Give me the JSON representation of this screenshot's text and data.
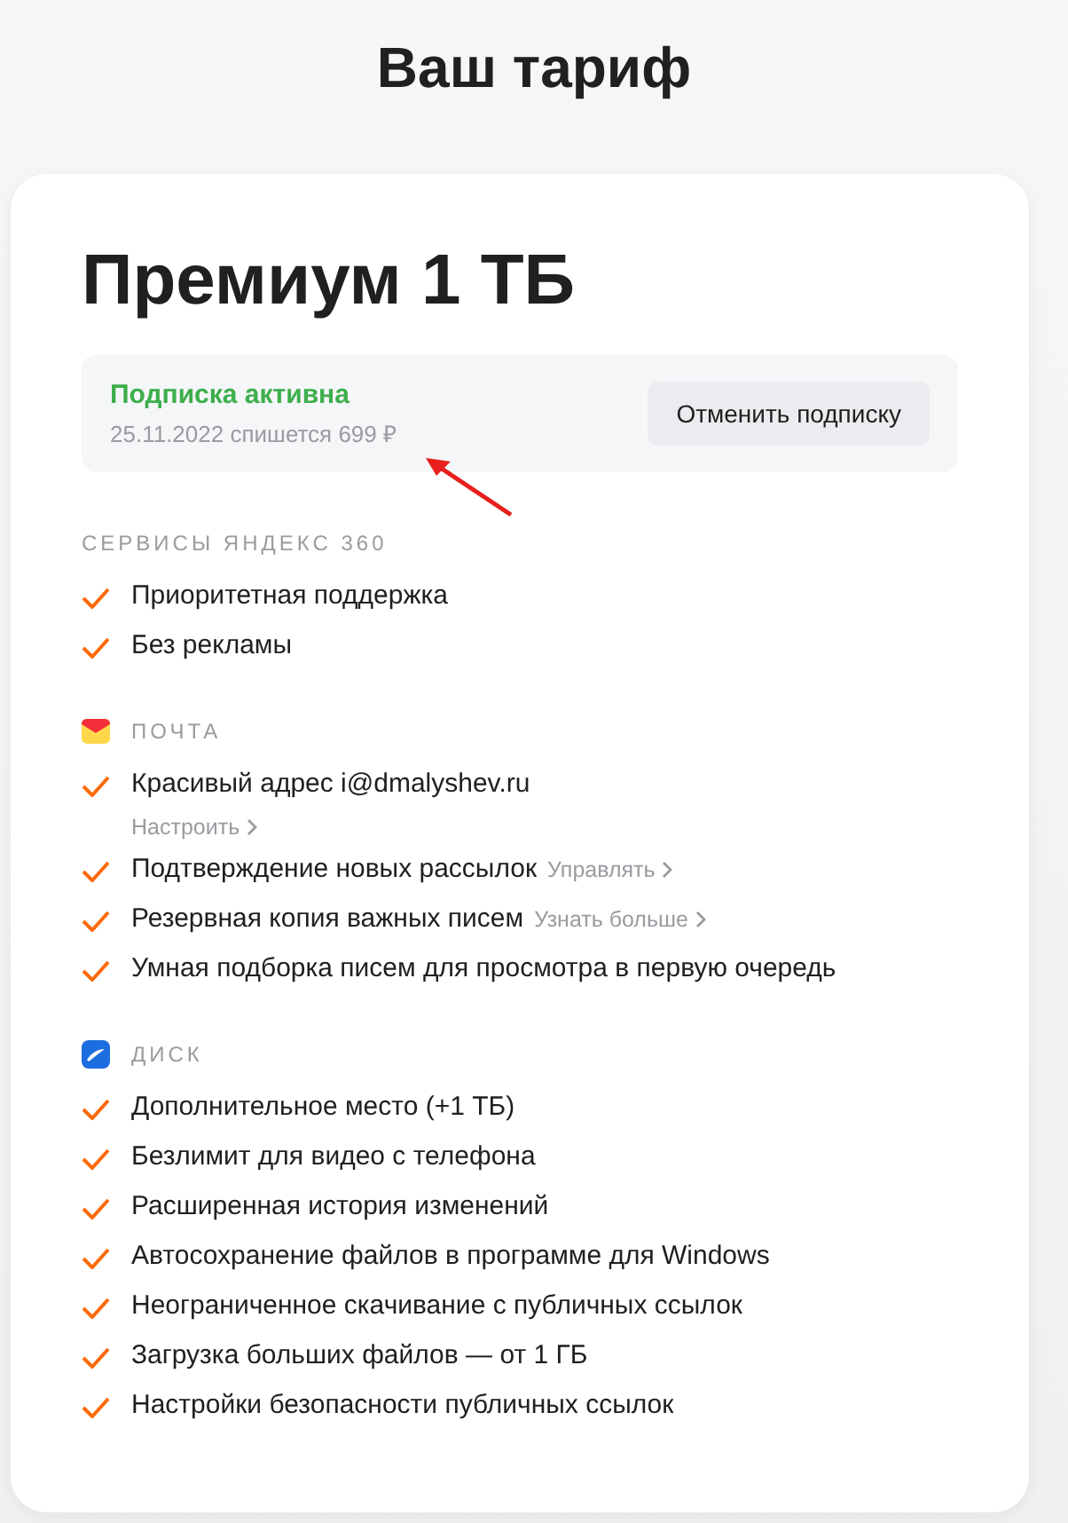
{
  "page_title": "Ваш тариф",
  "plan": {
    "name": "Премиум 1 ТБ",
    "status": {
      "label": "Подписка активна",
      "active": true,
      "note": "25.11.2022 спишется 699 ₽",
      "button": "Отменить подписку"
    }
  },
  "annotation": {
    "kind": "arrow"
  },
  "sections": [
    {
      "title": "СЕРВИСЫ ЯНДЕКС 360",
      "kind": "plain",
      "items": [
        {
          "text": "Приоритетная поддержка"
        },
        {
          "text": "Без рекламы"
        }
      ]
    },
    {
      "title": "ПОЧТА",
      "kind": "mail",
      "items": [
        {
          "text": "Красивый адрес i@dmalyshev.ru",
          "link": {
            "kind": "below",
            "label": "Настроить"
          }
        },
        {
          "text": "Подтверждение новых рассылок",
          "link": {
            "kind": "inline",
            "label": "Управлять"
          }
        },
        {
          "text": "Резервная копия важных писем",
          "link": {
            "kind": "inline",
            "label": "Узнать больше"
          }
        },
        {
          "text": "Умная подборка писем для просмотра в первую очередь"
        }
      ]
    },
    {
      "title": "ДИСК",
      "kind": "disk",
      "items": [
        {
          "text": "Дополнительное место (+1 ТБ)"
        },
        {
          "text": "Безлимит для видео с телефона"
        },
        {
          "text": "Расширенная история изменений"
        },
        {
          "text": "Автосохранение файлов в программе для Windows"
        },
        {
          "text": "Неограниченное скачивание с публичных ссылок"
        },
        {
          "text": "Загрузка больших файлов — от 1 ГБ"
        },
        {
          "text": "Настройки безопасности публичных ссылок"
        }
      ]
    }
  ]
}
